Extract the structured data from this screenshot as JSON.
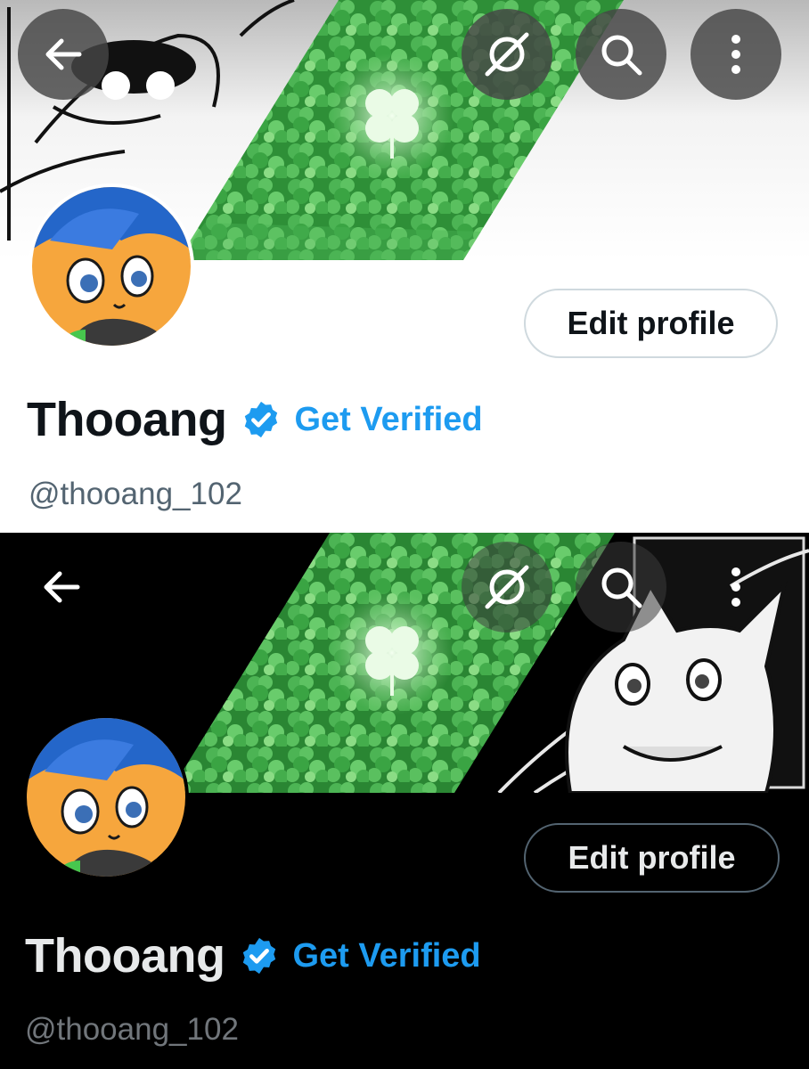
{
  "light_theme": {
    "display_name": "Thooang",
    "get_verified_label": "Get Verified",
    "handle": "@thooang_102",
    "edit_profile_label": "Edit profile",
    "icons": [
      "back-arrow-icon",
      "grok-icon",
      "search-icon",
      "more-vertical-icon",
      "verified-badge-icon"
    ]
  },
  "dark_theme": {
    "display_name": "Thooang",
    "get_verified_label": "Get Verified",
    "handle": "@thooang_102",
    "edit_profile_label": "Edit profile",
    "icons": [
      "back-arrow-icon",
      "grok-icon",
      "search-icon",
      "more-vertical-icon",
      "verified-badge-icon"
    ]
  },
  "colors": {
    "accent_blue": "#1d9bf0",
    "light_bg": "#ffffff",
    "dark_bg": "#000000",
    "clover_green": "#2f9a3a",
    "avatar_hair": "#2466c9",
    "avatar_skin": "#f7b44a"
  }
}
